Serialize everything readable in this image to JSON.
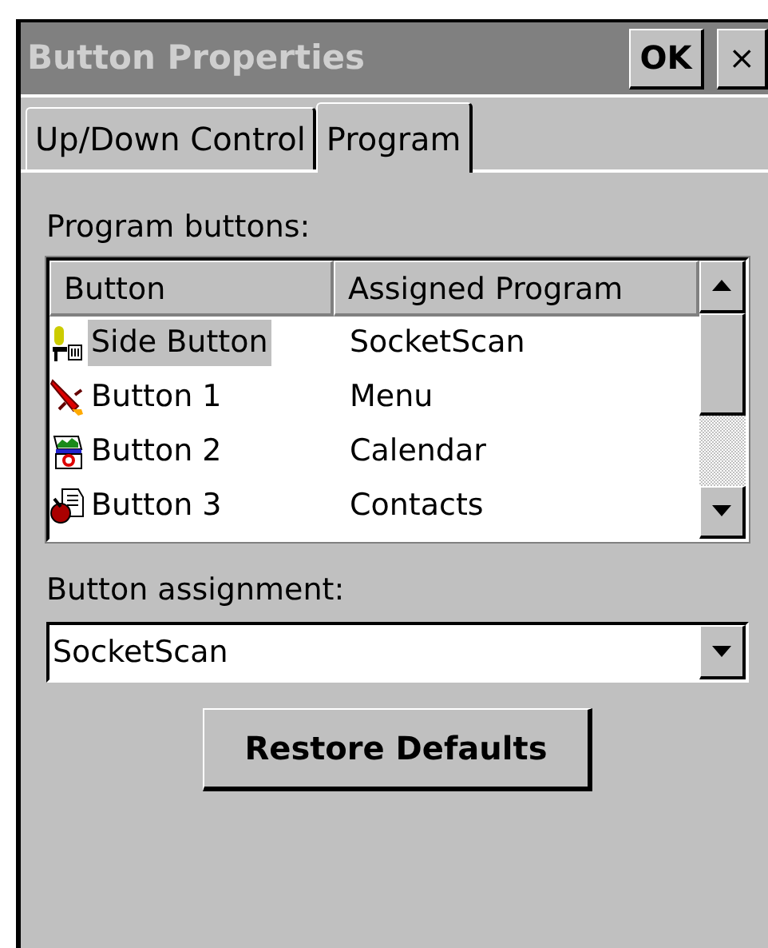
{
  "window": {
    "title": "Button Properties",
    "ok_label": "OK",
    "close_label": "×"
  },
  "tabs": [
    {
      "label": "Up/Down Control",
      "selected": false
    },
    {
      "label": "Program",
      "selected": true
    }
  ],
  "program_buttons": {
    "label": "Program buttons:",
    "columns": [
      "Button",
      "Assigned Program"
    ],
    "rows": [
      {
        "button": "Side Button",
        "program": "SocketScan",
        "selected": true
      },
      {
        "button": "Button 1",
        "program": "Menu",
        "selected": false
      },
      {
        "button": "Button 2",
        "program": "Calendar",
        "selected": false
      },
      {
        "button": "Button 3",
        "program": "Contacts",
        "selected": false
      }
    ]
  },
  "assignment": {
    "label": "Button assignment:",
    "value": "SocketScan"
  },
  "buttons": [
    "Restore Defaults"
  ]
}
